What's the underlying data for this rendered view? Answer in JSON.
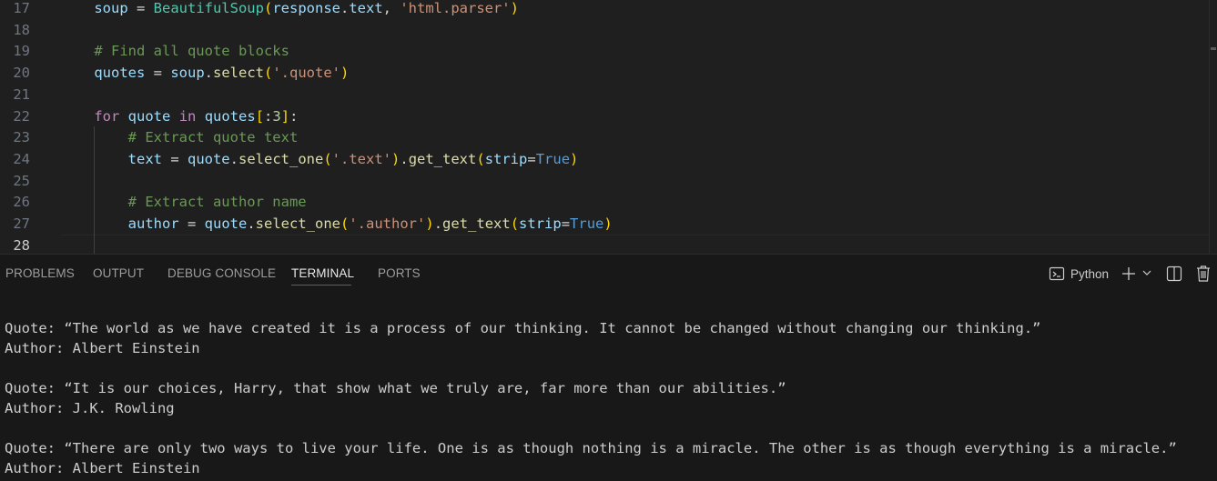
{
  "editor": {
    "lines": [
      {
        "num": "17",
        "tokens": [
          {
            "t": "    ",
            "c": "op"
          },
          {
            "t": "soup",
            "c": "var"
          },
          {
            "t": " = ",
            "c": "op"
          },
          {
            "t": "BeautifulSoup",
            "c": "cls"
          },
          {
            "t": "(",
            "c": "b1"
          },
          {
            "t": "response",
            "c": "var"
          },
          {
            "t": ".",
            "c": "op"
          },
          {
            "t": "text",
            "c": "var"
          },
          {
            "t": ", ",
            "c": "op"
          },
          {
            "t": "'html.parser'",
            "c": "str"
          },
          {
            "t": ")",
            "c": "b1"
          }
        ]
      },
      {
        "num": "18",
        "tokens": []
      },
      {
        "num": "19",
        "tokens": [
          {
            "t": "    ",
            "c": "op"
          },
          {
            "t": "# Find all quote blocks",
            "c": "cmt"
          }
        ]
      },
      {
        "num": "20",
        "tokens": [
          {
            "t": "    ",
            "c": "op"
          },
          {
            "t": "quotes",
            "c": "var"
          },
          {
            "t": " = ",
            "c": "op"
          },
          {
            "t": "soup",
            "c": "var"
          },
          {
            "t": ".",
            "c": "op"
          },
          {
            "t": "select",
            "c": "fn"
          },
          {
            "t": "(",
            "c": "b1"
          },
          {
            "t": "'.quote'",
            "c": "str"
          },
          {
            "t": ")",
            "c": "b1"
          }
        ]
      },
      {
        "num": "21",
        "tokens": []
      },
      {
        "num": "22",
        "tokens": [
          {
            "t": "    ",
            "c": "op"
          },
          {
            "t": "for",
            "c": "kw"
          },
          {
            "t": " ",
            "c": "op"
          },
          {
            "t": "quote",
            "c": "var"
          },
          {
            "t": " ",
            "c": "op"
          },
          {
            "t": "in",
            "c": "kw"
          },
          {
            "t": " ",
            "c": "op"
          },
          {
            "t": "quotes",
            "c": "var"
          },
          {
            "t": "[",
            "c": "b1"
          },
          {
            "t": ":",
            "c": "op"
          },
          {
            "t": "3",
            "c": "num"
          },
          {
            "t": "]",
            "c": "b1"
          },
          {
            "t": ":",
            "c": "op"
          }
        ]
      },
      {
        "num": "23",
        "tokens": [
          {
            "t": "        ",
            "c": "op"
          },
          {
            "t": "# Extract quote text",
            "c": "cmt"
          }
        ]
      },
      {
        "num": "24",
        "tokens": [
          {
            "t": "        ",
            "c": "op"
          },
          {
            "t": "text",
            "c": "var"
          },
          {
            "t": " = ",
            "c": "op"
          },
          {
            "t": "quote",
            "c": "var"
          },
          {
            "t": ".",
            "c": "op"
          },
          {
            "t": "select_one",
            "c": "fn"
          },
          {
            "t": "(",
            "c": "b1"
          },
          {
            "t": "'.text'",
            "c": "str"
          },
          {
            "t": ")",
            "c": "b1"
          },
          {
            "t": ".",
            "c": "op"
          },
          {
            "t": "get_text",
            "c": "fn"
          },
          {
            "t": "(",
            "c": "b1"
          },
          {
            "t": "strip",
            "c": "var"
          },
          {
            "t": "=",
            "c": "op"
          },
          {
            "t": "True",
            "c": "bool"
          },
          {
            "t": ")",
            "c": "b1"
          }
        ]
      },
      {
        "num": "25",
        "tokens": []
      },
      {
        "num": "26",
        "tokens": [
          {
            "t": "        ",
            "c": "op"
          },
          {
            "t": "# Extract author name",
            "c": "cmt"
          }
        ]
      },
      {
        "num": "27",
        "tokens": [
          {
            "t": "        ",
            "c": "op"
          },
          {
            "t": "author",
            "c": "var"
          },
          {
            "t": " = ",
            "c": "op"
          },
          {
            "t": "quote",
            "c": "var"
          },
          {
            "t": ".",
            "c": "op"
          },
          {
            "t": "select_one",
            "c": "fn"
          },
          {
            "t": "(",
            "c": "b1"
          },
          {
            "t": "'.author'",
            "c": "str"
          },
          {
            "t": ")",
            "c": "b1"
          },
          {
            "t": ".",
            "c": "op"
          },
          {
            "t": "get_text",
            "c": "fn"
          },
          {
            "t": "(",
            "c": "b1"
          },
          {
            "t": "strip",
            "c": "var"
          },
          {
            "t": "=",
            "c": "op"
          },
          {
            "t": "True",
            "c": "bool"
          },
          {
            "t": ")",
            "c": "b1"
          }
        ]
      },
      {
        "num": "28",
        "tokens": [],
        "active": true
      }
    ]
  },
  "panel": {
    "tabs": [
      {
        "id": "problems",
        "label": "PROBLEMS"
      },
      {
        "id": "output",
        "label": "OUTPUT"
      },
      {
        "id": "debug-console",
        "label": "DEBUG CONSOLE"
      },
      {
        "id": "terminal",
        "label": "TERMINAL",
        "active": true
      },
      {
        "id": "ports",
        "label": "PORTS"
      }
    ],
    "terminal_name": "Python",
    "icons": {
      "terminal": "terminal-icon",
      "add": "plus-icon",
      "dropdown": "chevron-down-icon",
      "split": "split-terminal-icon",
      "kill": "trash-icon"
    }
  },
  "terminal": {
    "lines": [
      "Quote: “The world as we have created it is a process of our thinking. It cannot be changed without changing our thinking.”",
      "Author: Albert Einstein",
      "",
      "Quote: “It is our choices, Harry, that show what we truly are, far more than our abilities.”",
      "Author: J.K. Rowling",
      "",
      "Quote: “There are only two ways to live your life. One is as though nothing is a miracle. The other is as though everything is a miracle.”",
      "Author: Albert Einstein"
    ]
  },
  "colors": {
    "editor_bg": "#1f1f1f",
    "panel_bg": "#181818",
    "accent": "#0078d4",
    "keyword": "#c586c0",
    "variable": "#9cdcfe",
    "string": "#ce9178",
    "comment": "#6a9955",
    "class": "#4ec9b0",
    "function": "#dcdcaa",
    "bool": "#569cd6"
  }
}
